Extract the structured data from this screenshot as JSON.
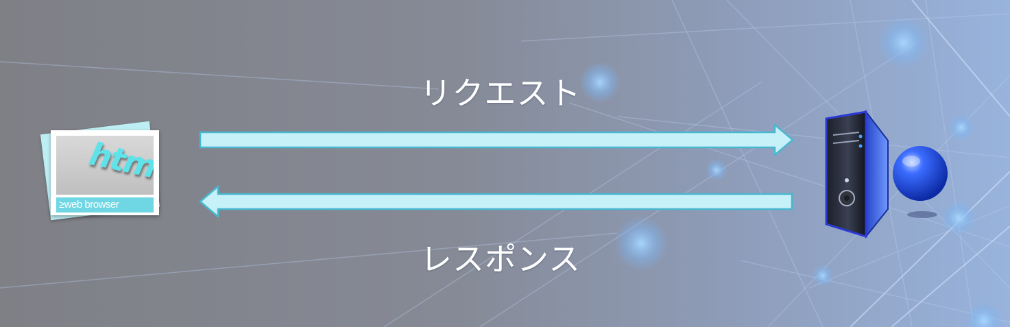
{
  "diagram": {
    "request_label": "リクエスト",
    "response_label": "レスポンス",
    "browser": {
      "icon": "html-web-browser-icon",
      "word": "html",
      "caption": "≥web browser"
    },
    "server": {
      "icon": "server-globe-icon"
    },
    "colors": {
      "arrow_fill": "#c6f1f8",
      "arrow_edge": "#49b7cf",
      "text": "#ffffff",
      "accent": "#5fe3ea",
      "server_blue": "#2a55e0"
    }
  }
}
